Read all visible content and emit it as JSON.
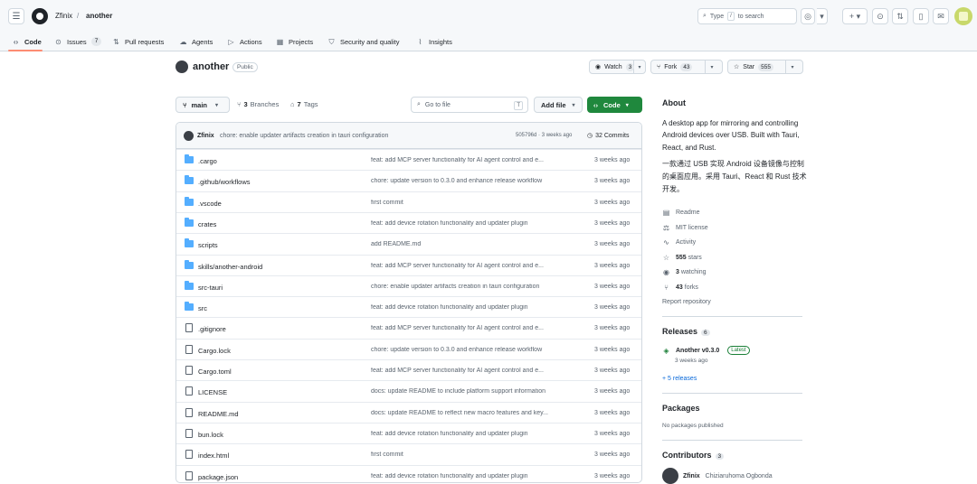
{
  "header": {
    "owner": "Zfinix",
    "separator": "/",
    "repo": "another",
    "search_prefix": "Type",
    "search_key": "/",
    "search_suffix": "to search"
  },
  "tabs": [
    {
      "label": "Code",
      "icon": "code-icon"
    },
    {
      "label": "Issues",
      "icon": "issue-icon",
      "count": "7"
    },
    {
      "label": "Pull requests",
      "icon": "pull-request-icon"
    },
    {
      "label": "Agents",
      "icon": "agents-icon"
    },
    {
      "label": "Actions",
      "icon": "play-icon"
    },
    {
      "label": "Projects",
      "icon": "table-icon"
    },
    {
      "label": "Security and quality",
      "icon": "shield-icon"
    },
    {
      "label": "Insights",
      "icon": "graph-icon"
    }
  ],
  "repo": {
    "name": "another",
    "visibility": "Public",
    "watch_label": "Watch",
    "watch_count": "3",
    "fork_label": "Fork",
    "fork_count": "43",
    "star_label": "Star",
    "star_count": "555"
  },
  "branchbar": {
    "branch": "main",
    "branches_count": "3",
    "branches_label": "Branches",
    "tags_count": "7",
    "tags_label": "Tags",
    "goto_placeholder": "Go to file",
    "goto_key": "T",
    "add_file": "Add file",
    "code": "Code"
  },
  "commit": {
    "user": "Zfinix",
    "message": "chore: enable updater artifacts creation in tauri configuration",
    "hash_time": "505796d · 3 weeks ago",
    "commits_count": "32 Commits"
  },
  "files": [
    {
      "name": ".cargo",
      "type": "folder",
      "message": "feat: add MCP server functionality for AI agent control and e...",
      "date": "3 weeks ago"
    },
    {
      "name": ".github/workflows",
      "type": "folder",
      "message": "chore: update version to 0.3.0 and enhance release workflow",
      "date": "3 weeks ago"
    },
    {
      "name": ".vscode",
      "type": "folder",
      "message": "first commit",
      "date": "3 weeks ago"
    },
    {
      "name": "crates",
      "type": "folder",
      "message": "feat: add device rotation functionality and updater plugin",
      "date": "3 weeks ago"
    },
    {
      "name": "scripts",
      "type": "folder",
      "message": "add README.md",
      "date": "3 weeks ago"
    },
    {
      "name": "skills/another-android",
      "type": "folder",
      "message": "feat: add MCP server functionality for AI agent control and e...",
      "date": "3 weeks ago"
    },
    {
      "name": "src-tauri",
      "type": "folder",
      "message": "chore: enable updater artifacts creation in tauri configuration",
      "date": "3 weeks ago"
    },
    {
      "name": "src",
      "type": "folder",
      "message": "feat: add device rotation functionality and updater plugin",
      "date": "3 weeks ago"
    },
    {
      "name": ".gitignore",
      "type": "file",
      "message": "feat: add MCP server functionality for AI agent control and e...",
      "date": "3 weeks ago"
    },
    {
      "name": "Cargo.lock",
      "type": "file",
      "message": "chore: update version to 0.3.0 and enhance release workflow",
      "date": "3 weeks ago"
    },
    {
      "name": "Cargo.toml",
      "type": "file",
      "message": "feat: add MCP server functionality for AI agent control and e...",
      "date": "3 weeks ago"
    },
    {
      "name": "LICENSE",
      "type": "file",
      "message": "docs: update README to include platform support information",
      "date": "3 weeks ago"
    },
    {
      "name": "README.md",
      "type": "file",
      "message": "docs: update README to reflect new macro features and key...",
      "date": "3 weeks ago"
    },
    {
      "name": "bun.lock",
      "type": "file",
      "message": "feat: add device rotation functionality and updater plugin",
      "date": "3 weeks ago"
    },
    {
      "name": "index.html",
      "type": "file",
      "message": "first commit",
      "date": "3 weeks ago"
    },
    {
      "name": "package.json",
      "type": "file",
      "message": "feat: add device rotation functionality and updater plugin",
      "date": "3 weeks ago"
    }
  ],
  "sidebar": {
    "about_title": "About",
    "description": "A desktop app for mirroring and controlling Android devices over USB. Built with Tauri, React, and Rust.",
    "description_cn": "一款通过 USB 实现 Android 设备镜像与控制的桌面应用。采用 Tauri、React 和 Rust 技术开发。",
    "links": [
      {
        "label": "Readme",
        "icon": "book-icon"
      },
      {
        "label": "MIT license",
        "icon": "law-icon"
      },
      {
        "label": "Activity",
        "icon": "pulse-icon"
      },
      {
        "count": "555",
        "label": "stars",
        "icon": "star-icon"
      },
      {
        "count": "3",
        "label": "watching",
        "icon": "eye-icon"
      },
      {
        "count": "43",
        "label": "forks",
        "icon": "fork-icon"
      }
    ],
    "report": "Report repository",
    "releases_title": "Releases",
    "releases_count": "6",
    "release_name": "Another v0.3.0",
    "release_badge": "Latest",
    "release_date": "3 weeks ago",
    "more_releases": "+ 5 releases",
    "packages_title": "Packages",
    "packages_text": "No packages published",
    "contributors_title": "Contributors",
    "contributors_count": "3",
    "contributor_user": "Zfinix",
    "contributor_name": "Chiziaruhoma Ogbonda"
  }
}
